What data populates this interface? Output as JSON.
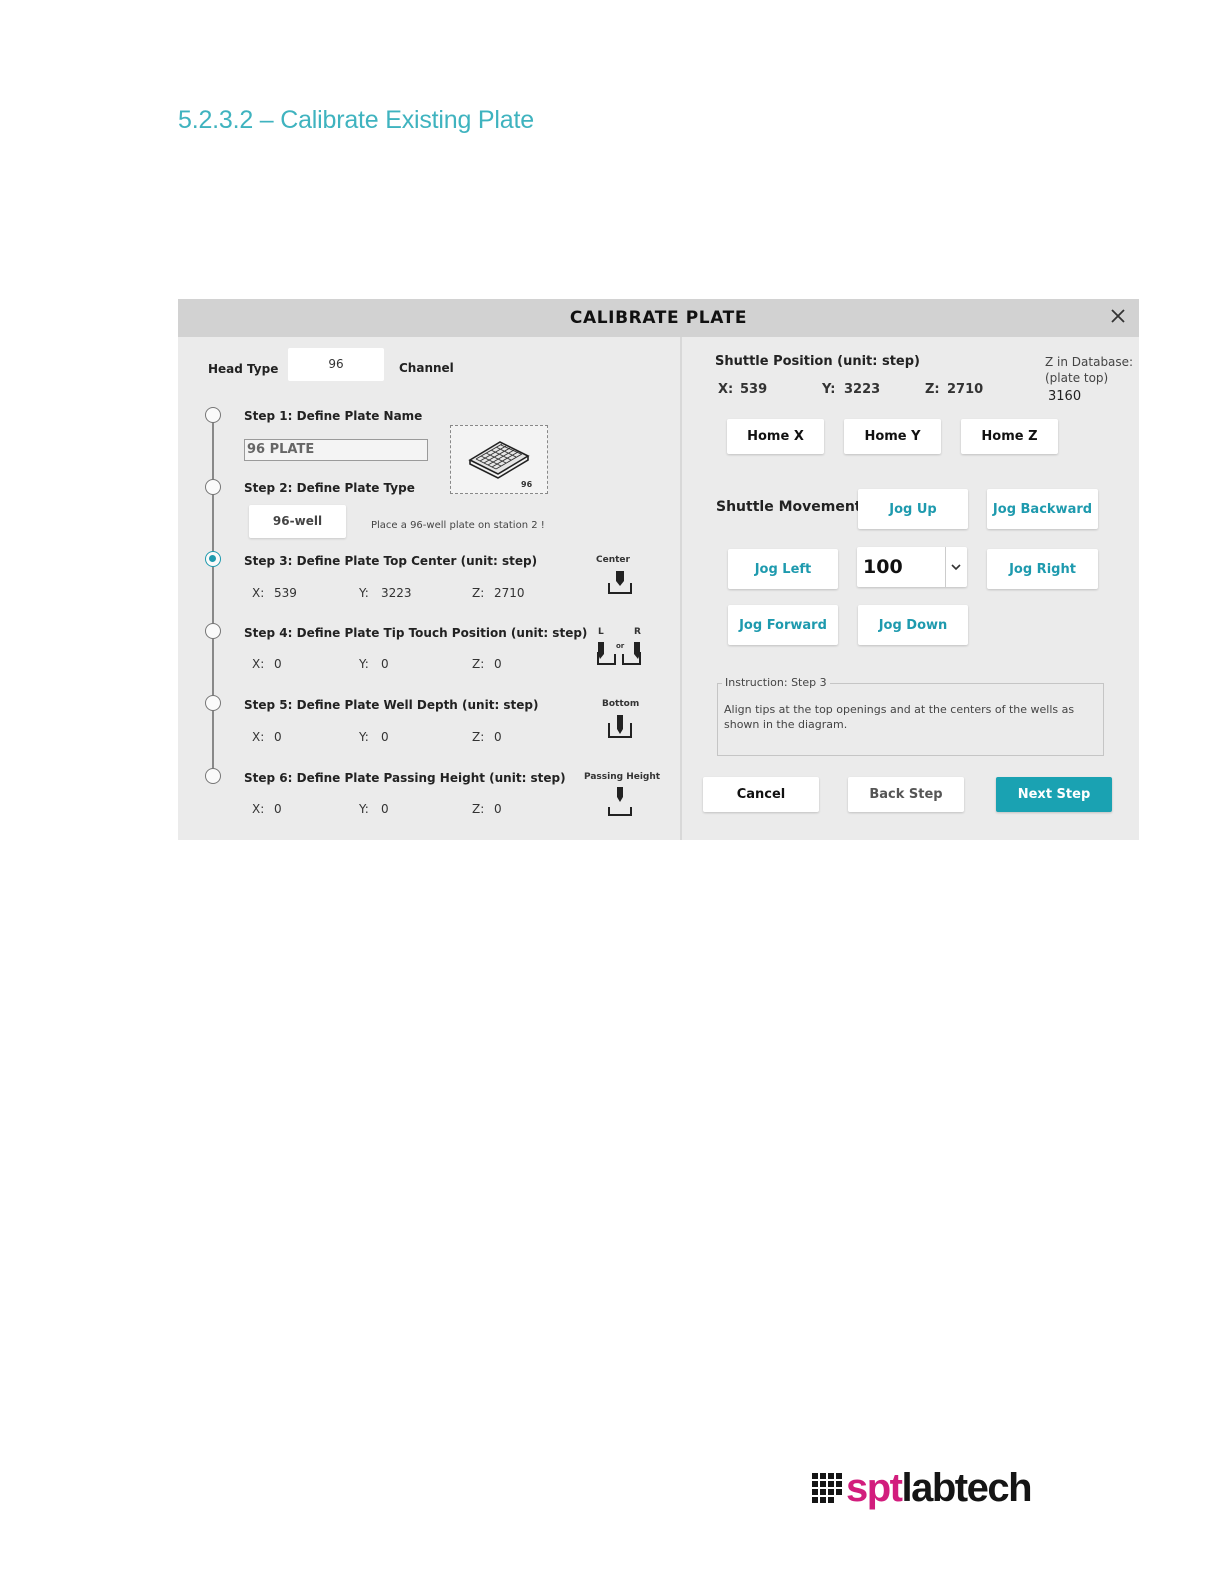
{
  "doc": {
    "heading": "5.2.3.2 – Calibrate Existing Plate"
  },
  "dialog": {
    "title": "CALIBRATE PLATE",
    "head_type_label": "Head Type",
    "head_type_value": "96",
    "channel_label": "Channel",
    "plate_image_label": "96",
    "steps": [
      {
        "label": "Step 1: Define Plate Name",
        "value": "96 PLATE"
      },
      {
        "label": "Step 2: Define Plate Type",
        "value": "96-well",
        "hint": "Place a 96-well plate on station 2 !"
      },
      {
        "label": "Step 3: Define Plate Top Center (unit: step)",
        "x": "539",
        "y": "3223",
        "z": "2710",
        "icon_label": "Center"
      },
      {
        "label": "Step 4: Define Plate Tip Touch Position (unit: step)",
        "x": "0",
        "y": "0",
        "z": "0",
        "icon_left": "L",
        "icon_right": "R",
        "icon_or": "or"
      },
      {
        "label": "Step 5: Define Plate Well Depth (unit: step)",
        "x": "0",
        "y": "0",
        "z": "0",
        "icon_label": "Bottom"
      },
      {
        "label": "Step 6: Define Plate Passing Height (unit: step)",
        "x": "0",
        "y": "0",
        "z": "0",
        "icon_label": "Passing Height"
      }
    ],
    "active_step": 3,
    "coord_keys": {
      "x": "X:",
      "y": "Y:",
      "z": "Z:"
    },
    "shuttle": {
      "position_label": "Shuttle Position (unit: step)",
      "x": "539",
      "y": "3223",
      "z": "2710",
      "z_db_label": "Z in Database:",
      "z_db_sub": "(plate top)",
      "z_db_value": "3160",
      "home_x": "Home X",
      "home_y": "Home Y",
      "home_z": "Home Z",
      "movement_label": "Shuttle Movement",
      "jog_up": "Jog Up",
      "jog_backward": "Jog Backward",
      "jog_left": "Jog Left",
      "jog_right": "Jog Right",
      "jog_forward": "Jog Forward",
      "jog_down": "Jog Down",
      "step_size": "100"
    },
    "instruction": {
      "legend": "Instruction: Step 3",
      "text": "Align tips at the top openings and at the centers of the wells as shown in the diagram."
    },
    "buttons": {
      "cancel": "Cancel",
      "back": "Back Step",
      "next": "Next Step"
    }
  },
  "logo": {
    "spt": "spt",
    "labtech": "labtech"
  },
  "colors": {
    "accent": "#1aa2b2",
    "heading": "#3fb3bf",
    "logo_pink": "#d21d7d"
  }
}
